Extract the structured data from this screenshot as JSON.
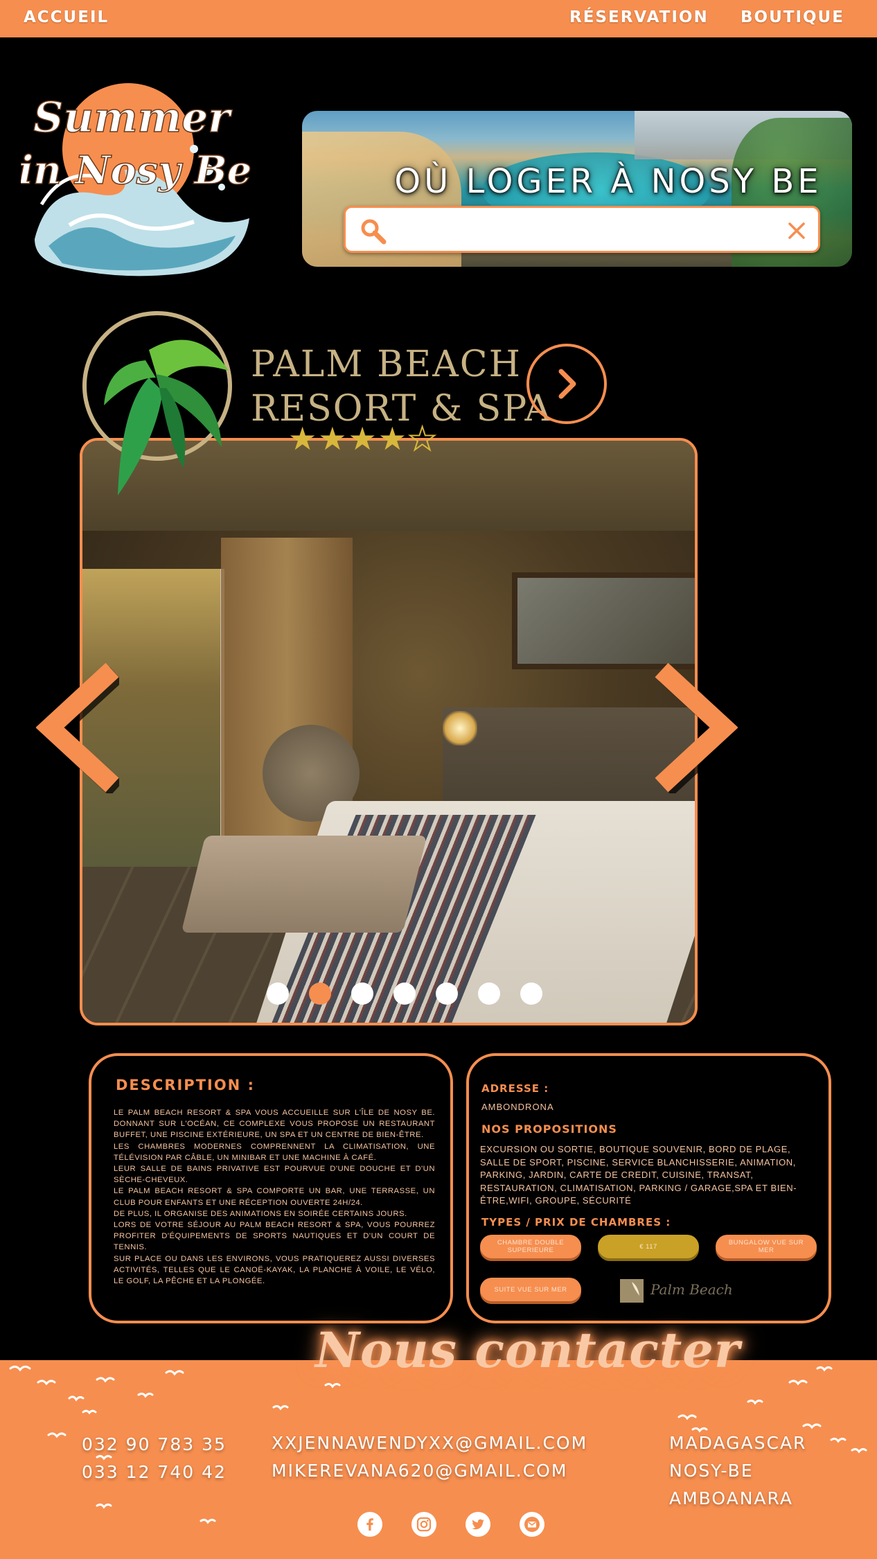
{
  "nav": {
    "home": "ACCUEIL",
    "reservation": "RÉSERVATION",
    "shop": "BOUTIQUE"
  },
  "logo": {
    "line1": "Summer",
    "line2": "in Nosy Be"
  },
  "hero": {
    "title": "OÙ LOGER À NOSY BE",
    "search_value": "",
    "search_icon": "search-icon",
    "clear_icon": "close-icon"
  },
  "hotel": {
    "name_line1": "PALM BEACH",
    "name_line2": "RESORT & SPA",
    "stars_filled": 4,
    "stars_total": 5,
    "stars_text": "★★★★",
    "star_empty": "★"
  },
  "gallery": {
    "slide_count": 7,
    "active_index": 1
  },
  "description": {
    "title": "DESCRIPTION :",
    "paragraphs": [
      "Le Palm Beach Resort & Spa vous accueille sur l'île de Nosy Be. Donnant sur l'océan, ce complexe vous propose un restaurant buffet, une piscine extérieure, un spa et un centre de bien-être.",
      "Les chambres modernes comprennent la climatisation, une télévision par câble, un minibar et une machine à café.",
      "Leur salle de bains privative est pourvue d'une douche et d'un sèche-cheveux.",
      "Le Palm Beach Resort & Spa comporte un bar, une terrasse, un club pour enfants et une réception ouverte 24h/24.",
      "De plus, il organise des animations en soirée certains jours.",
      "Lors de votre séjour au Palm Beach Resort & Spa, vous pourrez profiter d'équipements de sports nautiques et d'un court de tennis.",
      "Sur place ou dans les environs, vous pratiquerez aussi diverses activités, telles que le canoë-kayak, la planche à voile, le vélo, le golf, la pêche et la plongée."
    ]
  },
  "info": {
    "address_label": "ADRESSE :",
    "address": "AMBONDRONA",
    "proposals_label": "NOS PROPOSITIONS",
    "proposals": "EXCURSION OU SORTIE, BOUTIQUE SOUVENIR, BORD DE PLAGE, SALLE DE SPORT, PISCINE, SERVICE BLANCHISSERIE, ANIMATION, PARKING, JARDIN, CARTE DE CREDIT, CUISINE, TRANSAT, RESTAURATION, CLIMATISATION, PARKING / GARAGE,SPA ET BIEN-ÊTRE,WIFI, GROUPE, SÉCURITÉ",
    "rooms_label": "TYPES / PRIX DE CHAMBRES :",
    "room_double": "CHAMBRE DOUBLE SUPERIEURE",
    "price": "€ 117",
    "room_bungalow": "BUNGALOW VUE SUR MER",
    "room_suite": "SUITE VUE SUR MER",
    "mini_logo_text": "Palm Beach"
  },
  "contact": {
    "title": "Nous contacter",
    "phone1": "032 90 783 35",
    "phone2": "033 12 740 42",
    "email1": "XXJENNAWENDYXX@GMAIL.COM",
    "email2": "MIKEREVANA620@GMAIL.COM",
    "place1": "MADAGASCAR",
    "place2": "NOSY-BE",
    "place3": "AMBOANARA",
    "socials": [
      "facebook-icon",
      "instagram-icon",
      "twitter-icon",
      "mail-icon"
    ]
  },
  "colors": {
    "accent": "#f68e4f",
    "background": "#000000",
    "gold": "#c9a126",
    "brand_text": "#c7b284"
  }
}
